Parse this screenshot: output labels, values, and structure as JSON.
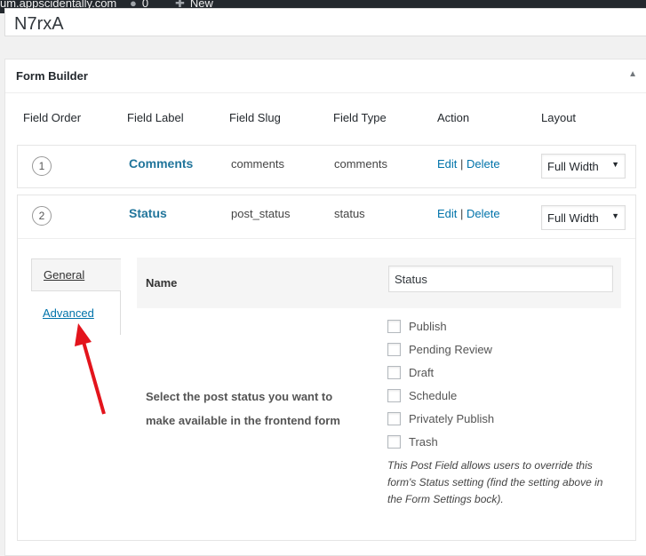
{
  "admin_bar": {
    "site": "um.appscidentally.com",
    "comments_count": "0",
    "new_label": "New"
  },
  "title_field": {
    "value": "N7rxA"
  },
  "form_builder": {
    "title": "Form Builder",
    "columns": [
      "Field Order",
      "Field Label",
      "Field Slug",
      "Field Type",
      "Action",
      "Layout"
    ],
    "rows": [
      {
        "order": "1",
        "label": "Comments",
        "slug": "comments",
        "type": "comments",
        "edit": "Edit",
        "sep": "|",
        "delete": "Delete",
        "layout": "Full Width"
      },
      {
        "order": "2",
        "label": "Status",
        "slug": "post_status",
        "type": "status",
        "edit": "Edit",
        "sep": "|",
        "delete": "Delete",
        "layout": "Full Width"
      }
    ],
    "tabs": {
      "general": "General",
      "advanced": "Advanced"
    },
    "name_label": "Name",
    "name_value": "Status",
    "status_description": "Select the post status you want to make available in the frontend form",
    "statuses": [
      "Publish",
      "Pending Review",
      "Draft",
      "Schedule",
      "Privately Publish",
      "Trash"
    ],
    "note": "This Post Field allows users to override this form's Status setting (find the setting above in the Form Settings bock)."
  },
  "colors": {
    "link": "#0073aa",
    "annotation_arrow": "#e3141c"
  }
}
